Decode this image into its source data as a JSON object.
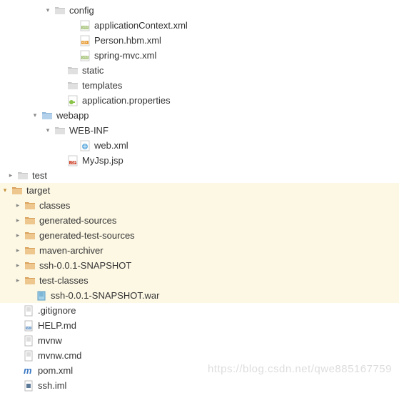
{
  "tree": {
    "config": "config",
    "applicationContext": "applicationContext.xml",
    "personHbm": "Person.hbm.xml",
    "springMvc": "spring-mvc.xml",
    "static": "static",
    "templates": "templates",
    "applicationProperties": "application.properties",
    "webapp": "webapp",
    "webinf": "WEB-INF",
    "webxml": "web.xml",
    "myjsp": "MyJsp.jsp",
    "test": "test",
    "target": "target",
    "classes": "classes",
    "generatedSources": "generated-sources",
    "generatedTestSources": "generated-test-sources",
    "mavenArchiver": "maven-archiver",
    "sshSnapshot": "ssh-0.0.1-SNAPSHOT",
    "testClasses": "test-classes",
    "sshWar": "ssh-0.0.1-SNAPSHOT.war",
    "gitignore": ".gitignore",
    "helpmd": "HELP.md",
    "mvnw": "mvnw",
    "mvnwcmd": "mvnw.cmd",
    "pomxml": "pom.xml",
    "sshiml": "ssh.iml"
  },
  "watermark": "https://blog.csdn.net/qwe885167759"
}
